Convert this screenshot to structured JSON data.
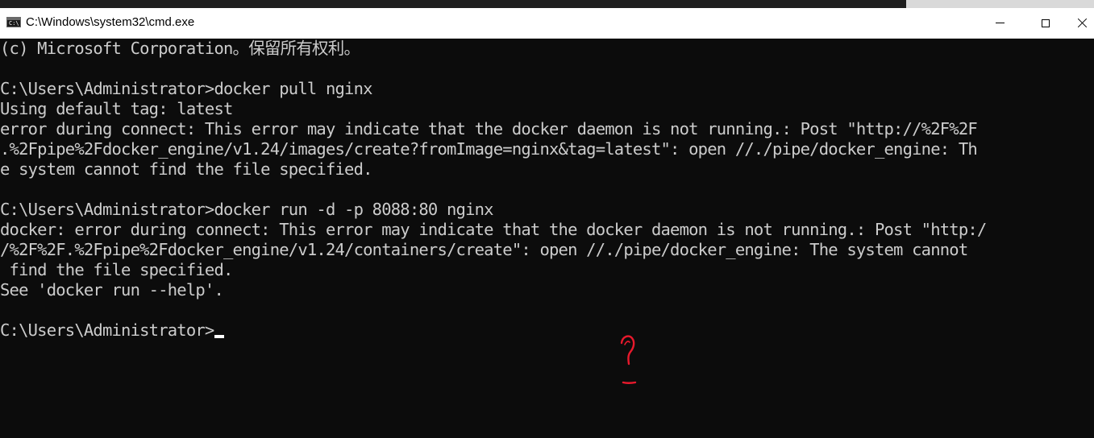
{
  "window": {
    "title": "C:\\Windows\\system32\\cmd.exe",
    "app_icon_label": "C:\\",
    "controls": {
      "minimize_icon": "minimize-icon",
      "maximize_icon": "maximize-icon",
      "close_icon": "close-icon"
    }
  },
  "console": {
    "lines": [
      "(c) Microsoft Corporation。保留所有权利。",
      "",
      "C:\\Users\\Administrator>docker pull nginx",
      "Using default tag: latest",
      "error during connect: This error may indicate that the docker daemon is not running.: Post \"http://%2F%2F",
      ".%2Fpipe%2Fdocker_engine/v1.24/images/create?fromImage=nginx&tag=latest\": open //./pipe/docker_engine: Th",
      "e system cannot find the file specified.",
      "",
      "C:\\Users\\Administrator>docker run -d -p 8088:80 nginx",
      "docker: error during connect: This error may indicate that the docker daemon is not running.: Post \"http:/",
      "/%2F%2F.%2Fpipe%2Fdocker_engine/v1.24/containers/create\": open //./pipe/docker_engine: The system cannot",
      " find the file specified.",
      "See 'docker run --help'.",
      "",
      "C:\\Users\\Administrator>"
    ],
    "text_color": "#cccccc",
    "background_color": "#0c0c0c"
  },
  "annotation": {
    "icon": "handwritten-question-mark-icon",
    "color": "#e8192c"
  }
}
